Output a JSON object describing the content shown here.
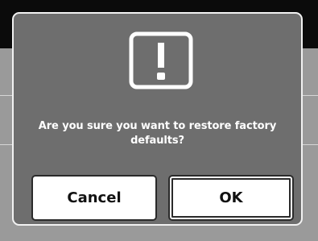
{
  "dialog": {
    "icon": "alert-exclamation-icon",
    "message": "Are you sure you want to restore factory defaults?",
    "cancel_label": "Cancel",
    "ok_label": "OK"
  },
  "colors": {
    "dialog_background": "#6e6e6e",
    "dialog_border": "#f2f2f2",
    "backdrop": "#9a9a9a",
    "top_bar": "#0b0b0b",
    "button_background": "#ffffff"
  }
}
